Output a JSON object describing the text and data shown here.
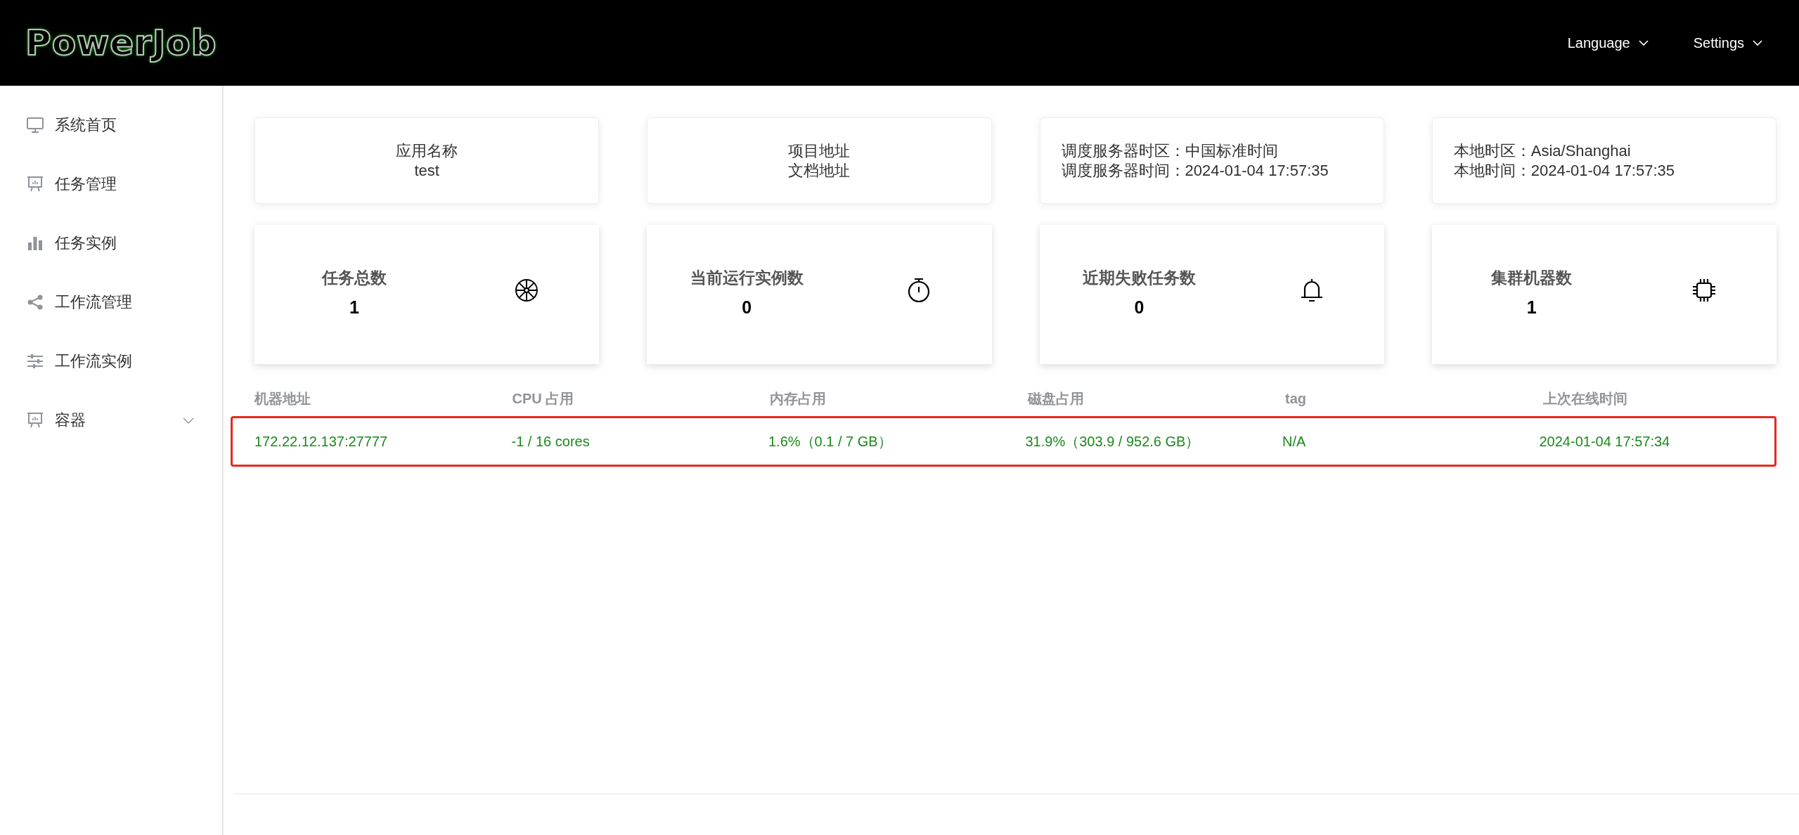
{
  "header": {
    "logo": "PowerJob",
    "menus": [
      {
        "label": "Language"
      },
      {
        "label": "Settings"
      }
    ]
  },
  "sidebar": {
    "items": [
      {
        "label": "系统首页",
        "kind": "link"
      },
      {
        "label": "任务管理",
        "kind": "link"
      },
      {
        "label": "任务实例",
        "kind": "link"
      },
      {
        "label": "工作流管理",
        "kind": "link"
      },
      {
        "label": "工作流实例",
        "kind": "link"
      },
      {
        "label": "容器",
        "kind": "submenu"
      }
    ]
  },
  "info_cards": [
    {
      "kind": "center",
      "lines": [
        "应用名称",
        "test"
      ]
    },
    {
      "kind": "center",
      "lines": [
        "项目地址",
        "文档地址"
      ]
    },
    {
      "kind": "left",
      "lines": [
        "调度服务器时区：中国标准时间",
        "调度服务器时间：2024-01-04 17:57:35"
      ]
    },
    {
      "kind": "left",
      "lines": [
        "本地时区：Asia/Shanghai",
        "本地时间：2024-01-04 17:57:35"
      ]
    }
  ],
  "stat_cards": [
    {
      "title": "任务总数",
      "value": "1"
    },
    {
      "title": "当前运行实例数",
      "value": "0"
    },
    {
      "title": "近期失败任务数",
      "value": "0"
    },
    {
      "title": "集群机器数",
      "value": "1"
    }
  ],
  "table": {
    "columns": [
      "机器地址",
      "CPU 占用",
      "内存占用",
      "磁盘占用",
      "tag",
      "上次在线时间"
    ],
    "rows": [
      {
        "highlighted": true,
        "cells": [
          "172.22.12.137:27777",
          "-1 / 16 cores",
          "1.6%（0.1 / 7 GB）",
          "31.9%（303.9 / 952.6 GB）",
          "N/A",
          "2024-01-04 17:57:34"
        ]
      }
    ]
  }
}
